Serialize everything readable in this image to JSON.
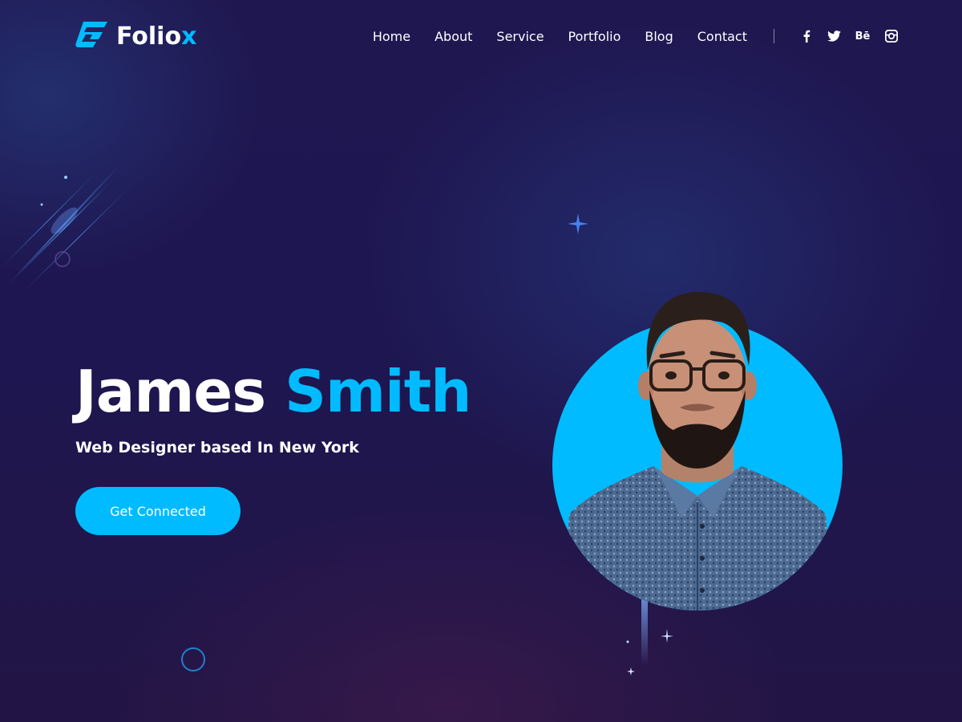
{
  "brand": {
    "name_main": "Folio",
    "name_accent": "x",
    "logo_icon": "folio-f-icon"
  },
  "nav": {
    "items": [
      "Home",
      "About",
      "Service",
      "Portfolio",
      "Blog",
      "Contact"
    ]
  },
  "social": [
    {
      "icon": "facebook-icon"
    },
    {
      "icon": "twitter-icon"
    },
    {
      "icon": "behance-icon",
      "text": "Bē"
    },
    {
      "icon": "instagram-icon"
    }
  ],
  "hero": {
    "first_name": "James",
    "last_name": "Smith",
    "subtitle": "Web Designer based In New York",
    "cta_label": "Get Connected",
    "portrait_icon": "profile-photo"
  },
  "colors": {
    "accent": "#00bbff",
    "background": "#1e1650",
    "text": "#ffffff"
  }
}
